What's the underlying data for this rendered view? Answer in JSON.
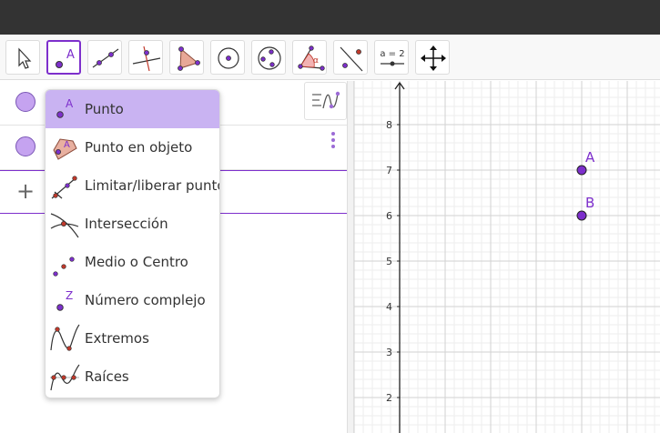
{
  "toolbar": {
    "tools": [
      {
        "name": "move-tool",
        "icon": "arrow-cursor-icon"
      },
      {
        "name": "point-tool",
        "icon": "point-icon",
        "label": "A",
        "active": true
      },
      {
        "name": "line-tool",
        "icon": "line-icon"
      },
      {
        "name": "perpendicular-tool",
        "icon": "perpendicular-icon"
      },
      {
        "name": "polygon-tool",
        "icon": "polygon-icon"
      },
      {
        "name": "circle-center-point-tool",
        "icon": "circle-icon"
      },
      {
        "name": "conic-tool",
        "icon": "ellipse-icon"
      },
      {
        "name": "angle-tool",
        "icon": "angle-icon",
        "label": "α"
      },
      {
        "name": "reflect-tool",
        "icon": "reflect-icon"
      },
      {
        "name": "slider-tool",
        "icon": "slider-icon",
        "label": "a = 2"
      },
      {
        "name": "move-view-tool",
        "icon": "move-arrows-icon"
      }
    ]
  },
  "menu": {
    "items": [
      {
        "label": "Punto",
        "icon": "point-icon",
        "icon_label": "A",
        "selected": true
      },
      {
        "label": "Punto en objeto",
        "icon": "point-on-object-icon",
        "icon_label": "A"
      },
      {
        "label": "Limitar/liberar punto",
        "icon": "attach-detach-icon"
      },
      {
        "label": "Intersección",
        "icon": "intersect-icon"
      },
      {
        "label": "Medio o Centro",
        "icon": "midpoint-icon"
      },
      {
        "label": "Número complejo",
        "icon": "complex-number-icon",
        "icon_label": "Z"
      },
      {
        "label": "Extremos",
        "icon": "extremum-icon"
      },
      {
        "label": "Raíces",
        "icon": "roots-icon"
      }
    ]
  },
  "algebra": {
    "add_symbol": "+"
  },
  "graphics": {
    "y_ticks": [
      "8",
      "7",
      "6",
      "5",
      "4",
      "3",
      "2"
    ],
    "points": [
      {
        "label": "A",
        "x": 4,
        "y": 7
      },
      {
        "label": "B",
        "x": 4,
        "y": 6
      }
    ]
  },
  "colors": {
    "accent": "#7d2fcc",
    "point_fill": "#7d2fcc",
    "selected_bg": "#c9b3f2",
    "titlebar": "#333333"
  }
}
